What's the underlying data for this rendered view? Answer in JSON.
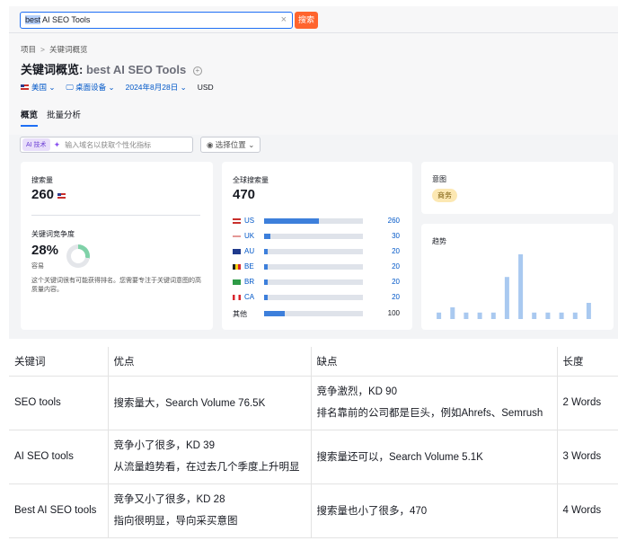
{
  "search": {
    "highlight": "best",
    "rest": " AI SEO Tools",
    "clear": "×",
    "button": "搜索"
  },
  "breadcrumb": {
    "root": "项目",
    "sep": ">",
    "current": "关键词概览"
  },
  "page_title": {
    "prefix": "关键词概览:",
    "keyword": "best AI SEO Tools",
    "add": "+"
  },
  "filters": {
    "country": "美国",
    "device": "桌面设备",
    "date": "2024年8月28日",
    "currency": "USD"
  },
  "tabs": [
    "概览",
    "批量分析"
  ],
  "ai_bar": {
    "badge": "AI 技术",
    "placeholder": "输入域名以获取个性化指标",
    "location": "选择位置"
  },
  "volume": {
    "label": "搜索量",
    "value": "260"
  },
  "kd": {
    "label": "关键词竞争度",
    "value": "28%",
    "level": "容易",
    "percent": 28,
    "note": "这个关键词很有可能获得排名。您需要专注于关键词意图的高质量内容。"
  },
  "global": {
    "label": "全球搜索量",
    "value": "470",
    "rows": [
      {
        "code": "US",
        "value": "260",
        "fraction": 0.55
      },
      {
        "code": "UK",
        "value": "30",
        "fraction": 0.06
      },
      {
        "code": "AU",
        "value": "20",
        "fraction": 0.04
      },
      {
        "code": "BE",
        "value": "20",
        "fraction": 0.04
      },
      {
        "code": "BR",
        "value": "20",
        "fraction": 0.04
      },
      {
        "code": "CA",
        "value": "20",
        "fraction": 0.04
      }
    ],
    "other_label": "其他",
    "other_value": "100",
    "other_fraction": 0.21
  },
  "intent": {
    "label": "意图",
    "value": "商务"
  },
  "trend": {
    "label": "趋势",
    "values": [
      0.1,
      0.18,
      0.1,
      0.1,
      0.1,
      0.65,
      1.0,
      0.1,
      0.1,
      0.1,
      0.1,
      0.25
    ]
  },
  "table": {
    "headers": [
      "关键词",
      "优点",
      "缺点",
      "长度"
    ],
    "rows": [
      {
        "keyword": "SEO tools",
        "pros": [
          "搜索量大，Search Volume 76.5K"
        ],
        "cons": [
          "竞争激烈，KD 90",
          "排名靠前的公司都是巨头，例如Ahrefs、Semrush"
        ],
        "length": "2 Words"
      },
      {
        "keyword": "AI SEO tools",
        "pros": [
          "竞争小了很多，KD 39",
          "从流量趋势看，在过去几个季度上升明显"
        ],
        "cons": [
          "搜索量还可以，Search Volume 5.1K"
        ],
        "length": "3 Words"
      },
      {
        "keyword": "Best AI SEO tools",
        "pros": [
          "竞争又小了很多，KD 28",
          "指向很明显，导向采买意图"
        ],
        "cons": [
          "搜索量也小了很多，470"
        ],
        "length": "4 Words"
      }
    ]
  },
  "colors": {
    "accent": "#1e6ff5",
    "search_button": "#ff642d",
    "bar": "#3d7fdb",
    "trend": "#a9c9f0",
    "kd": "#7fd1a8"
  }
}
